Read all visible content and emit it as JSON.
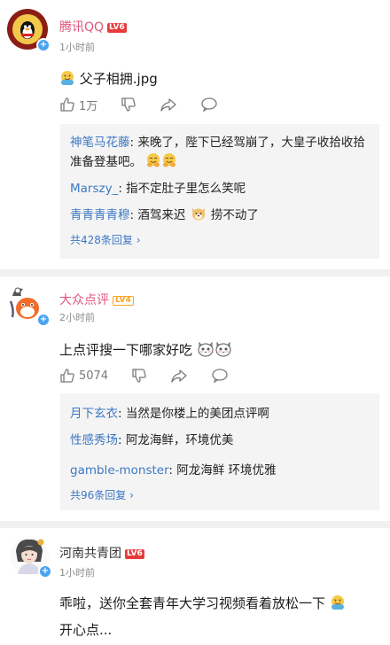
{
  "posts": [
    {
      "user": "腾讯QQ",
      "level": "LV6",
      "time": "1小时前",
      "text": "父子相拥.jpg",
      "like_count": "1万",
      "replies": [
        {
          "user": "神笔马花藤",
          "text": ": 来晚了，陛下已经驾崩了，大皇子收拾收拾准备登基吧。"
        },
        {
          "user": "Marszy_",
          "text": ": 指不定肚子里怎么笑呢"
        },
        {
          "user": "青青青青穆",
          "text_before": ": 酒驾来迟 ",
          "text_after": " 捞不动了"
        }
      ],
      "more_replies": "共428条回复 ›"
    },
    {
      "user": "大众点评",
      "level": "LV4",
      "time": "2小时前",
      "text": "上点评搜一下哪家好吃",
      "like_count": "5074",
      "replies": [
        {
          "user": "月下玄衣",
          "text": ": 当然是你楼上的美团点评啊"
        },
        {
          "user": "性感秀场",
          "text": ": 阿龙海鲜，环境优美"
        },
        {
          "user": "gamble-monster",
          "text": ": 阿龙海鲜 环境优雅"
        }
      ],
      "more_replies": "共96条回复 ›"
    },
    {
      "user": "河南共青团",
      "level": "LV6",
      "time": "1小时前",
      "text_line1": "乖啦，送你全套青年大学习视频看着放松一下",
      "text_line2": "开心点..."
    }
  ],
  "colors": {
    "username": "#e2567b",
    "reply_name": "#3d78c4",
    "level_red": "#e83a3a",
    "level_orange": "#f6a623",
    "verified_badge": "#4aa3f0"
  },
  "icons": [
    "hug-emoji",
    "like-icon",
    "dislike-icon",
    "share-icon",
    "comment-icon",
    "dog-emoji",
    "cat-emoji",
    "qq-penguin-avatar",
    "dianping-avatar",
    "gongqingtuan-avatar"
  ]
}
